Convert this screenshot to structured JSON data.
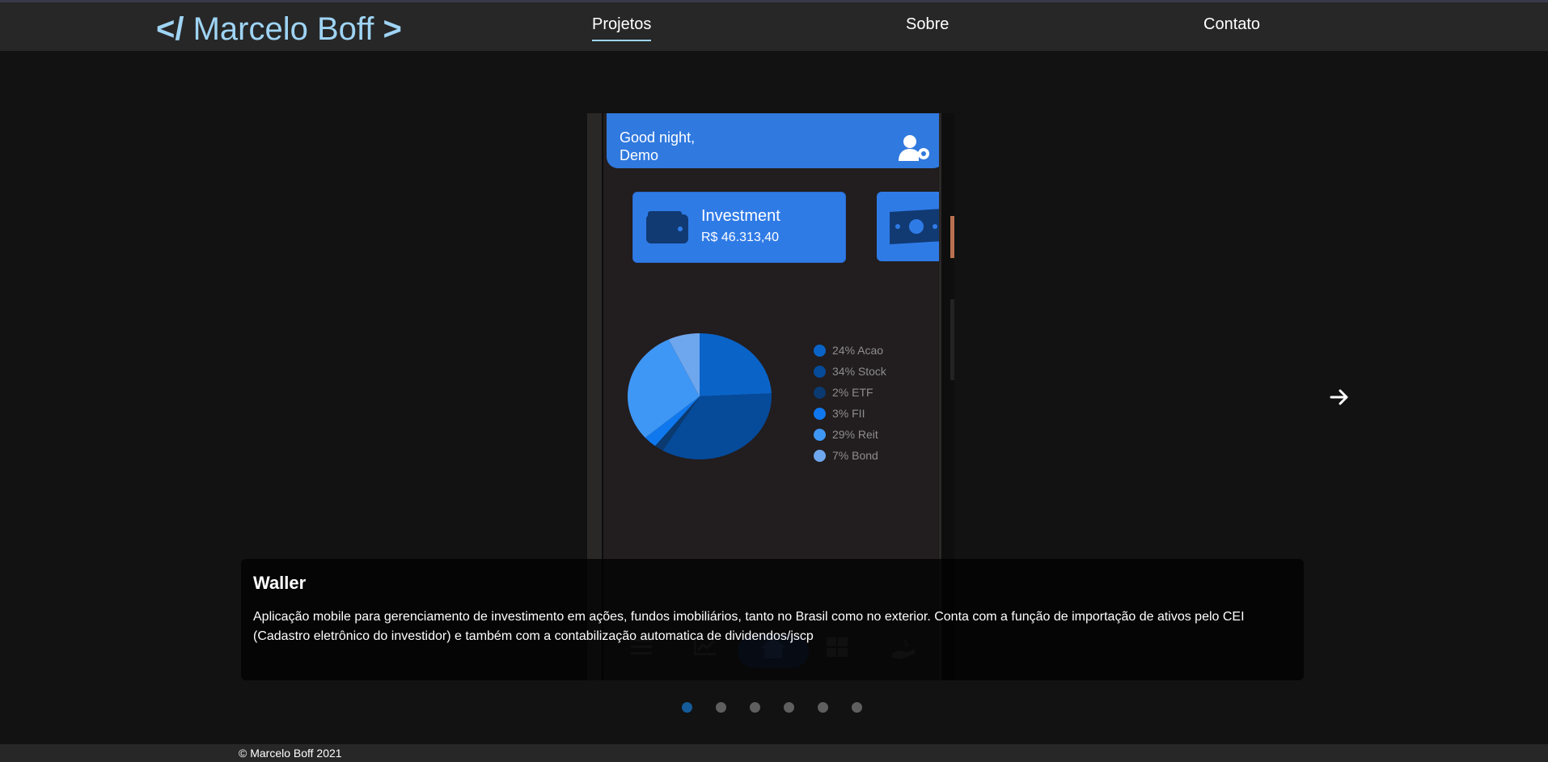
{
  "header": {
    "logo": {
      "open_bracket": "</",
      "name": "Marcelo Boff",
      "close_bracket": ">"
    },
    "nav": [
      {
        "label": "Projetos",
        "active": true
      },
      {
        "label": "Sobre",
        "active": false
      },
      {
        "label": "Contato",
        "active": false
      }
    ],
    "accent_color": "#9fd4f4"
  },
  "carousel": {
    "slide": {
      "title": "Waller",
      "description": "Aplicação mobile para gerenciamento de investimento em ações, fundos imobiliários, tanto no Brasil como no exterior. Conta com a função de importação de ativos pelo CEI (Cadastro eletrônico do investidor) e também com a contabilização automatica de dividendos/jscp",
      "screenshot": {
        "greeting": "Good night,\nDemo",
        "card_title": "Investment",
        "card_value": "R$ 46.313,40",
        "icons": [
          "user-gear-icon",
          "wallet-icon",
          "money-icon",
          "menu-icon",
          "chart-icon",
          "home-icon",
          "grid-icon",
          "hand-dollar-icon"
        ],
        "chart_data": {
          "type": "pie",
          "title": "",
          "categories": [
            "Acao",
            "Stock",
            "ETF",
            "FII",
            "Reit",
            "Bond"
          ],
          "values": [
            24,
            34,
            2,
            3,
            29,
            7
          ],
          "legend": [
            {
              "label": "24% Acao",
              "color": "#0a64c8"
            },
            {
              "label": "34% Stock",
              "color": "#064a9a"
            },
            {
              "label": "2% ETF",
              "color": "#0a3a70"
            },
            {
              "label": "3% FII",
              "color": "#0f78ee"
            },
            {
              "label": "29% Reit",
              "color": "#3f97f5"
            },
            {
              "label": "7% Bond",
              "color": "#6fa7ee"
            }
          ],
          "legend_position": "right"
        }
      }
    },
    "indicators": {
      "count": 6,
      "active_index": 0
    },
    "next_icon": "arrow-right-icon"
  },
  "footer": {
    "copyright": "© Marcelo Boff 2021"
  }
}
